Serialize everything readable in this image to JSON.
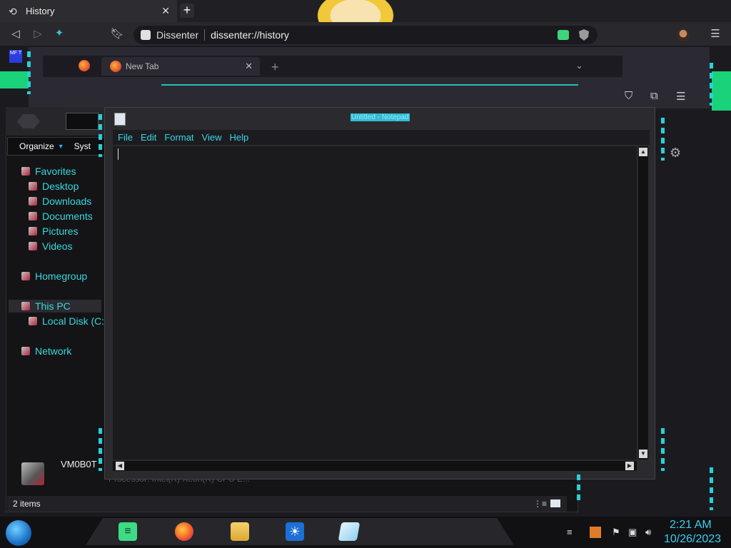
{
  "browser": {
    "tab_title": "History",
    "tab_icon": "history-icon",
    "site_name": "Dissenter",
    "url": "dissenter://history",
    "new_tab_symbol": "+",
    "close_symbol": "✕"
  },
  "firefox": {
    "tab_title": "New Tab",
    "close_symbol": "✕",
    "plus_symbol": "+",
    "chevron_symbol": "⌄"
  },
  "desktop": {
    "mft_label": "MF T"
  },
  "explorer": {
    "toolbar": {
      "organize": "Organize",
      "system": "Syst"
    },
    "nav": {
      "favorites": "Favorites",
      "desktop": "Desktop",
      "downloads": "Downloads",
      "documents": "Documents",
      "pictures": "Pictures",
      "videos": "Videos",
      "homegroup": "Homegroup",
      "this_pc": "This PC",
      "local_disk": "Local Disk (C:",
      "network": "Network"
    },
    "details": {
      "computer_name": "VM0B0T",
      "processor": "Processor:  Intel(R) Xeon(R) CPU E..."
    },
    "status": {
      "items": "2 items"
    }
  },
  "notepad": {
    "title": "Untitled - Notepad",
    "menu": [
      "File",
      "Edit",
      "Format",
      "View",
      "Help"
    ]
  },
  "taskbar": {
    "clock_time": "2:21 AM",
    "clock_date": "10/26/2023"
  },
  "colors": {
    "accent_cyan": "#27d0d8",
    "accent_green": "#19d27a",
    "menu_text": "#37d8e2",
    "clock_text": "#38d0f0"
  }
}
